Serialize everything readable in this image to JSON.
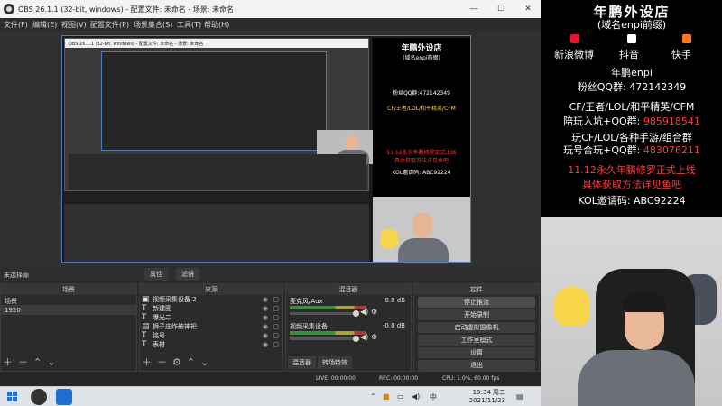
{
  "window": {
    "title": "OBS 26.1.1 (32-bit, windows) - 配置文件: 未命名 - 场景: 未命名",
    "controls": {
      "minimize": "—",
      "maximize": "☐",
      "close": "✕"
    }
  },
  "menu": [
    "文件(F)",
    "编辑(E)",
    "视图(V)",
    "配置文件(P)",
    "场景集合(S)",
    "工具(T)",
    "帮助(H)"
  ],
  "status_line": {
    "no_source": "未选择源",
    "properties": "属性",
    "filters": "滤镜"
  },
  "scenes": {
    "header": "场景",
    "items": [
      "场景",
      "1920"
    ],
    "selected_index": 1
  },
  "sources": {
    "header": "来源",
    "items": [
      {
        "name": "视频采集设备 2",
        "icon": "camera-icon"
      },
      {
        "name": "新建图",
        "icon": "text-icon"
      },
      {
        "name": "曝光二",
        "icon": "text-icon"
      },
      {
        "name": "狮子庄炸破神祀",
        "icon": "image-icon"
      },
      {
        "name": "铭号",
        "icon": "text-icon"
      },
      {
        "name": "表材",
        "icon": "text-icon"
      }
    ]
  },
  "mixer": {
    "header": "混音器",
    "channels": [
      {
        "name": "麦克风/Aux",
        "db": "0.0 dB"
      },
      {
        "name": "视频采集设备",
        "db": "-0.0 dB"
      }
    ],
    "tabs": [
      "混音器",
      "转场特效"
    ]
  },
  "controls": {
    "header": "控件",
    "buttons": [
      "停止推流",
      "开始录制",
      "启动虚拟摄像机",
      "工作室模式",
      "设置",
      "退出"
    ]
  },
  "statusbar": {
    "live": "LIVE: 00:00:00",
    "rec": "REC: 00:00:00",
    "cpu": "CPU: 1.0%, 60.00 fps"
  },
  "taskbar": {
    "time": "19:34 周二",
    "date": "2021/11/23",
    "ime": "中",
    "apps": [
      "obs-icon",
      "browser-icon"
    ]
  },
  "overlay": {
    "shop_title": "年鹏外设店",
    "shop_sub": "(域名enpi前缀)",
    "platforms": [
      "新浪微博",
      "抖音",
      "快手"
    ],
    "name_line": "年鹏enpi",
    "fans_label": "粉丝QQ群:",
    "fans_num": "472142349",
    "line1": "CF/王者/LOL/和平精英/CFM",
    "line2_label": "陪玩入坑+QQ群:",
    "line2_num": "985918541",
    "line3": "玩CF/LOL/各种手游/组合群",
    "line4_label": "玩号合玩+QQ群:",
    "line4_num": "483076211",
    "line5": "11.12永久年鹏修罗正式上线",
    "line6": "具体获取方法详见鱼吧",
    "kol": "KOL邀请码: ABC92224"
  },
  "colors": {
    "accent_red": "#ff3a3a",
    "accent_yellow": "#ffd53a",
    "preview_border": "#4f7ab3",
    "obs_bg": "#2a2a2a"
  }
}
